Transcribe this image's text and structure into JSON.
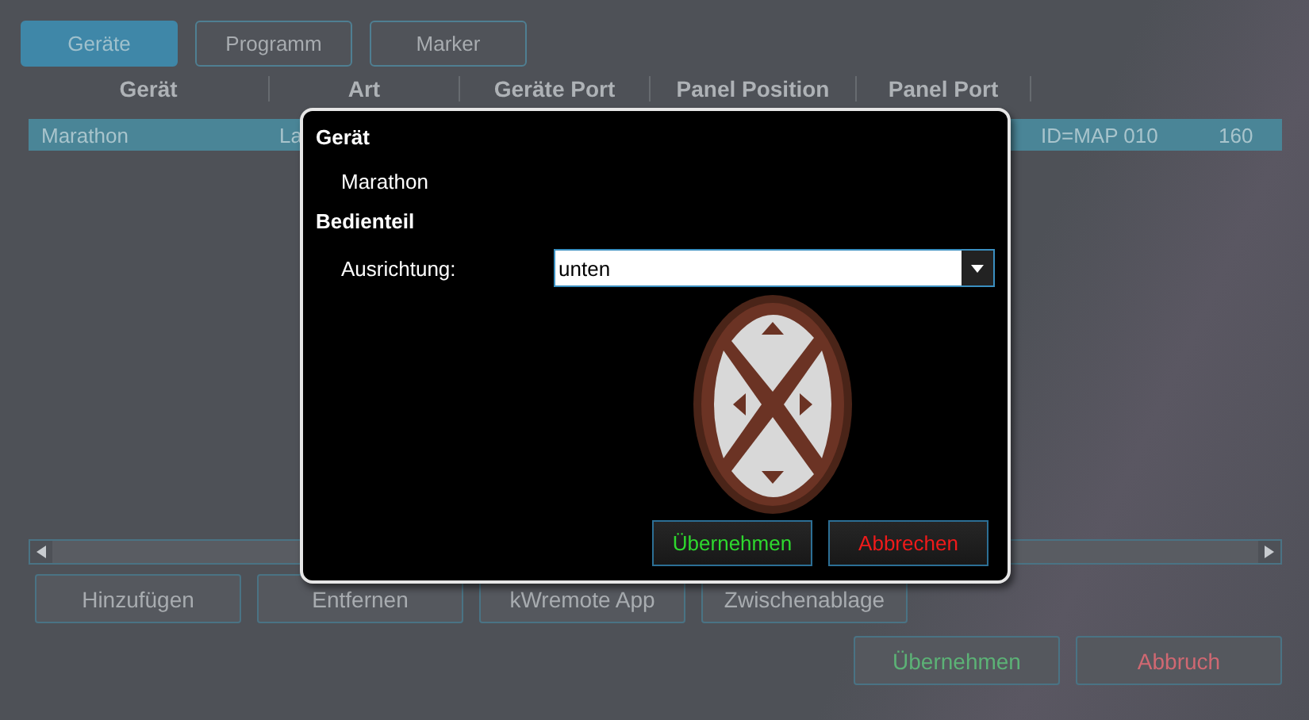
{
  "tabs": [
    {
      "label": "Geräte",
      "selected": true
    },
    {
      "label": "Programm",
      "selected": false
    },
    {
      "label": "Marker",
      "selected": false
    }
  ],
  "table": {
    "columns": [
      "Gerät",
      "Art",
      "Geräte Port",
      "Panel Position",
      "Panel Port"
    ],
    "rows": [
      {
        "geraet": "Marathon",
        "art": "La",
        "column_6": "ID=MAP 010",
        "column_7": "160",
        "selected": true
      }
    ]
  },
  "actions": [
    "Hinzufügen",
    "Entfernen",
    "kWremote App",
    "Zwischenablage"
  ],
  "footer": {
    "apply": "Übernehmen",
    "cancel": "Abbruch"
  },
  "dialog": {
    "device_heading": "Gerät",
    "device_name": "Marathon",
    "panel_heading": "Bedienteil",
    "orientation_label": "Ausrichtung:",
    "orientation_value": "unten",
    "apply": "Übernehmen",
    "cancel": "Abbrechen"
  }
}
